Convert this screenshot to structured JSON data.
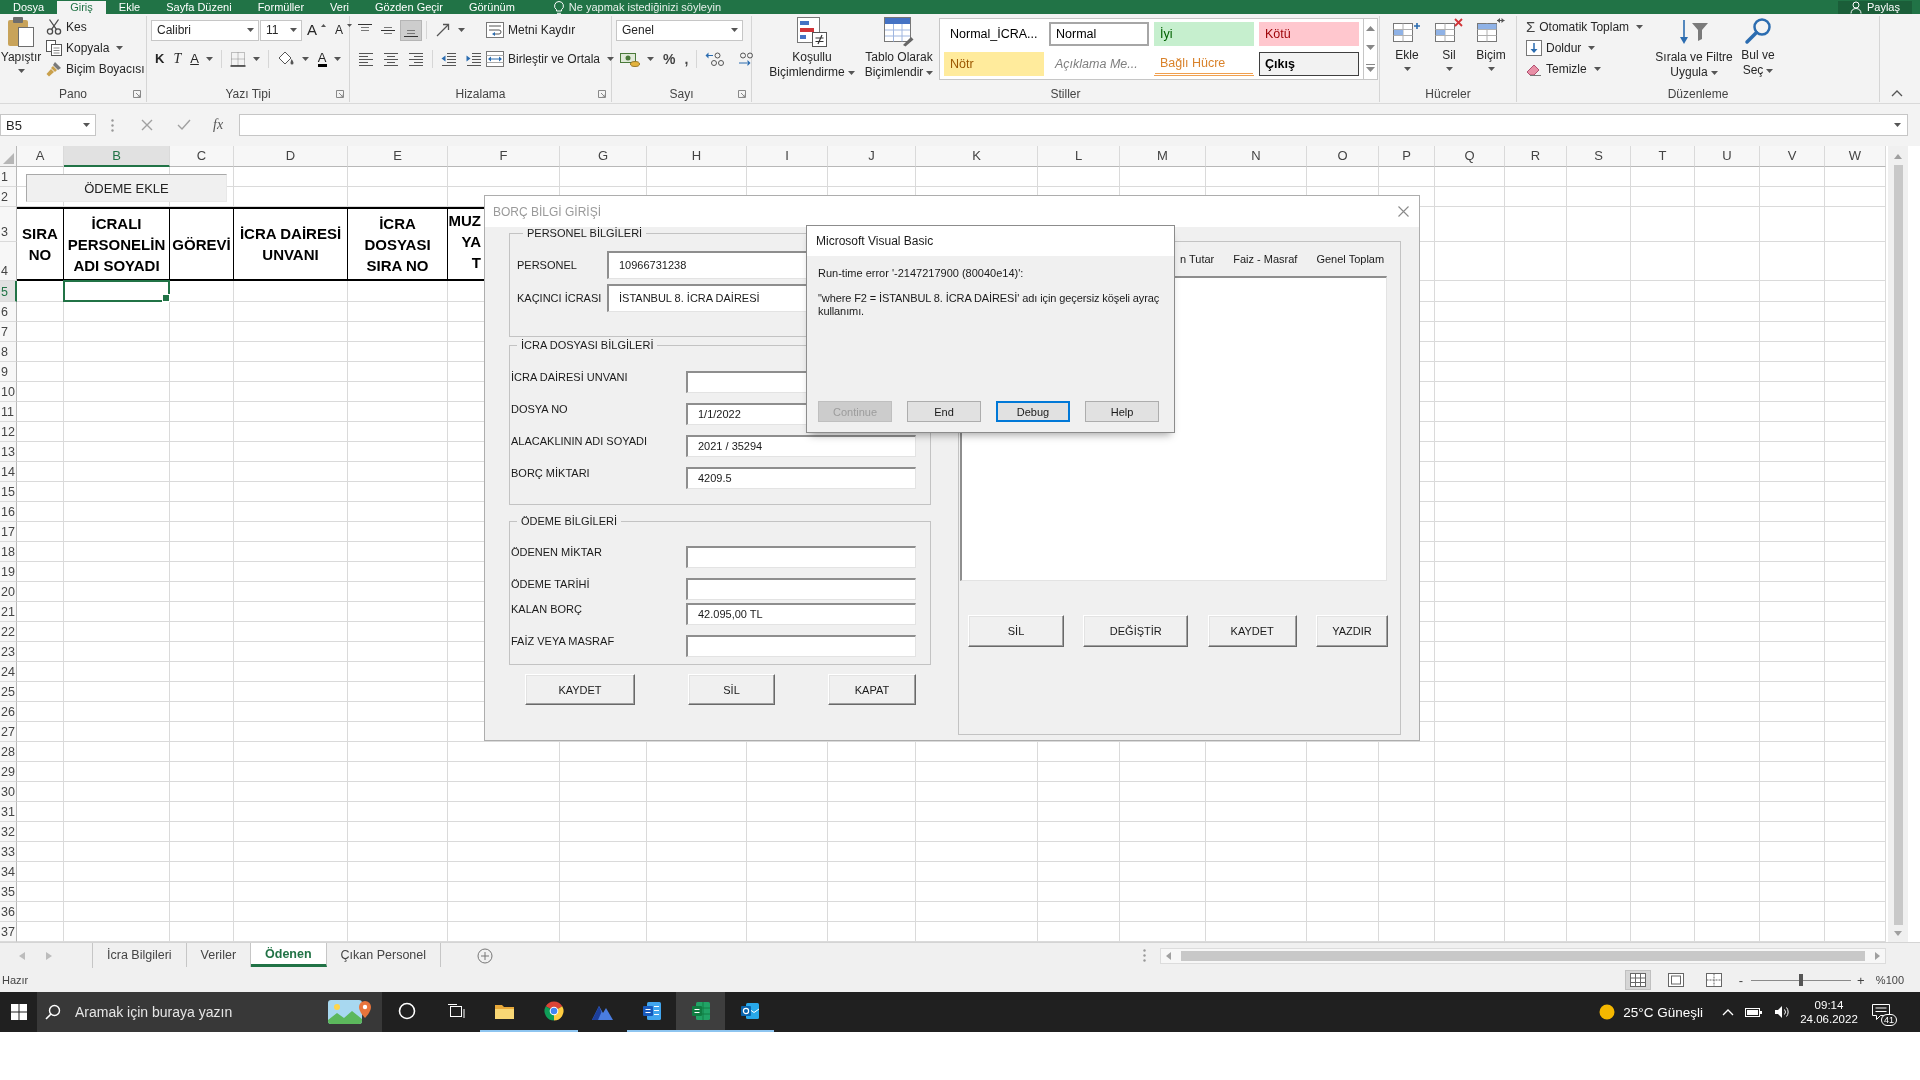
{
  "ribbon_tabs": [
    {
      "label": "Dosya",
      "selected": false
    },
    {
      "label": "Giriş",
      "selected": true
    },
    {
      "label": "Ekle",
      "selected": false
    },
    {
      "label": "Sayfa Düzeni",
      "selected": false
    },
    {
      "label": "Formüller",
      "selected": false
    },
    {
      "label": "Veri",
      "selected": false
    },
    {
      "label": "Gözden Geçir",
      "selected": false
    },
    {
      "label": "Görünüm",
      "selected": false
    }
  ],
  "tell_me": "Ne yapmak istediğinizi söyleyin",
  "share": "Paylaş",
  "ribbon": {
    "clipboard": {
      "label": "Pano",
      "paste": "Yapıştır",
      "cut": "Kes",
      "copy": "Kopyala",
      "format_painter": "Biçim Boyacısı"
    },
    "font": {
      "label": "Yazı Tipi",
      "font_name": "Calibri",
      "font_size": "11",
      "grow": "A",
      "shrink": "A",
      "bold": "K",
      "italic": "T",
      "underline": "A",
      "font_color": "A"
    },
    "alignment": {
      "label": "Hizalama",
      "vertical": [
        {
          "kind": "top",
          "on": false
        },
        {
          "kind": "middle",
          "on": false
        },
        {
          "kind": "bottom",
          "on": true
        }
      ],
      "horizontal": [
        {
          "kind": "left",
          "on": false
        },
        {
          "kind": "center",
          "on": false
        },
        {
          "kind": "right",
          "on": false
        }
      ],
      "wrap_text": "Metni Kaydır",
      "merge_center": "Birleştir ve Ortala"
    },
    "number": {
      "label": "Sayı",
      "format": "Genel",
      "percent": "%",
      "comma": ","
    },
    "styles": {
      "label": "Stiller",
      "conditional": "Koşullu Biçimlendirme",
      "format_table": "Tablo Olarak Biçimlendir",
      "gallery": [
        {
          "label": "Normal_İCRA...",
          "kind": "custom",
          "selected": false
        },
        {
          "label": "Normal",
          "kind": "normal",
          "selected": true
        },
        {
          "label": "İyi",
          "kind": "good",
          "selected": false
        },
        {
          "label": "Kötü",
          "kind": "bad",
          "selected": false
        },
        {
          "label": "Nötr",
          "kind": "neutral",
          "selected": false
        },
        {
          "label": "Açıklama Me...",
          "kind": "explanatory",
          "selected": false
        },
        {
          "label": "Bağlı Hücre",
          "kind": "linked",
          "selected": false
        },
        {
          "label": "Çıkış",
          "kind": "output",
          "selected": false
        }
      ]
    },
    "cells": {
      "label": "Hücreler",
      "buttons": [
        {
          "kind": "insert",
          "label": "Ekle"
        },
        {
          "kind": "delete",
          "label": "Sil"
        },
        {
          "kind": "format",
          "label": "Biçim"
        }
      ]
    },
    "editing": {
      "label": "Düzenleme",
      "autosum_symbol": "Σ",
      "autosum": "Otomatik Toplam",
      "fill": "Doldur",
      "clear": "Temizle",
      "sort_filter": "Sırala ve Filtre Uygula",
      "find_select": "Bul ve Seç"
    }
  },
  "formula_bar": {
    "name_box": "B5",
    "function_symbol": "fx"
  },
  "sheet": {
    "columns": [
      {
        "label": "A",
        "selected": false
      },
      {
        "label": "B",
        "selected": true
      },
      {
        "label": "C",
        "selected": false
      },
      {
        "label": "D",
        "selected": false
      },
      {
        "label": "E",
        "selected": false
      },
      {
        "label": "F",
        "selected": false
      },
      {
        "label": "G",
        "selected": false
      },
      {
        "label": "H",
        "selected": false
      },
      {
        "label": "I",
        "selected": false
      },
      {
        "label": "J",
        "selected": false
      },
      {
        "label": "K",
        "selected": false
      },
      {
        "label": "L",
        "selected": false
      },
      {
        "label": "M",
        "selected": false
      },
      {
        "label": "N",
        "selected": false
      },
      {
        "label": "O",
        "selected": false
      },
      {
        "label": "P",
        "selected": false
      },
      {
        "label": "Q",
        "selected": false
      },
      {
        "label": "R",
        "selected": false
      },
      {
        "label": "S",
        "selected": false
      },
      {
        "label": "T",
        "selected": false
      },
      {
        "label": "U",
        "selected": false
      },
      {
        "label": "V",
        "selected": false
      },
      {
        "label": "W",
        "selected": false
      }
    ],
    "rows": [
      {
        "label": "1",
        "selected": false
      },
      {
        "label": "2",
        "selected": false
      },
      {
        "label": "3",
        "selected": false
      },
      {
        "label": "4",
        "selected": false
      },
      {
        "label": "5",
        "selected": true
      },
      {
        "label": "6",
        "selected": false
      },
      {
        "label": "7",
        "selected": false
      },
      {
        "label": "8",
        "selected": false
      },
      {
        "label": "9",
        "selected": false
      },
      {
        "label": "10",
        "selected": false
      },
      {
        "label": "11",
        "selected": false
      },
      {
        "label": "12",
        "selected": false
      },
      {
        "label": "13",
        "selected": false
      },
      {
        "label": "14",
        "selected": false
      },
      {
        "label": "15",
        "selected": false
      },
      {
        "label": "16",
        "selected": false
      },
      {
        "label": "17",
        "selected": false
      },
      {
        "label": "18",
        "selected": false
      },
      {
        "label": "19",
        "selected": false
      },
      {
        "label": "20",
        "selected": false
      },
      {
        "label": "21",
        "selected": false
      },
      {
        "label": "22",
        "selected": false
      },
      {
        "label": "23",
        "selected": false
      },
      {
        "label": "24",
        "selected": false
      },
      {
        "label": "25",
        "selected": false
      },
      {
        "label": "26",
        "selected": false
      },
      {
        "label": "27",
        "selected": false
      },
      {
        "label": "28",
        "selected": false
      },
      {
        "label": "29",
        "selected": false
      },
      {
        "label": "30",
        "selected": false
      },
      {
        "label": "31",
        "selected": false
      },
      {
        "label": "32",
        "selected": false
      },
      {
        "label": "33",
        "selected": false
      },
      {
        "label": "34",
        "selected": false
      },
      {
        "label": "35",
        "selected": false
      },
      {
        "label": "36",
        "selected": false
      },
      {
        "label": "37",
        "selected": false
      }
    ],
    "macro_button": "ÖDEME EKLE",
    "header_cells": [
      "SIRA NO",
      "İCRALI PERSONELİN ADI SOYADI",
      "GÖREVİ",
      "İCRA DAİRESİ UNVANI",
      "İCRA DOSYASI SIRA NO",
      "MUZ YA T"
    ]
  },
  "form": {
    "title": "BORÇ BİLGİ GİRİŞİ",
    "sections": [
      {
        "title": "PERSONEL BİLGİLERİ",
        "kind": "multiline",
        "fields": [
          {
            "label": "PERSONEL",
            "value": "10966731238"
          },
          {
            "label": "KAÇINCI İCRASI",
            "value": "İSTANBUL 8. İCRA DAİRESİ"
          }
        ]
      },
      {
        "title": "İCRA DOSYASI BİLGİLERİ",
        "kind": "singleline",
        "fields": [
          {
            "label": "İCRA DAİRESİ UNVANI"
          },
          {
            "label": "DOSYA NO",
            "value": "1/1/2022"
          },
          {
            "label": "ALACAKLININ ADI SOYADI",
            "value": "2021 / 35294"
          },
          {
            "label": "BORÇ MİKTARI",
            "value": "4209.5"
          }
        ]
      },
      {
        "title": "ÖDEME BİLGİLERİ",
        "kind": "singleline",
        "fields": [
          {
            "label": "ÖDENEN MİKTAR"
          },
          {
            "label": "ÖDEME TARİHİ"
          },
          {
            "label": "KALAN BORÇ",
            "value": "42.095,00 TL"
          },
          {
            "label": "FAİZ VEYA MASRAF"
          }
        ]
      }
    ],
    "buttons": [
      "KAYDET",
      "SİL",
      "KAPAT"
    ],
    "list_columns": [
      "n Tutar",
      "Faiz - Masraf",
      "Genel Toplam"
    ],
    "list_buttons": [
      "SİL",
      "DEĞİŞTİR",
      "KAYDET",
      "YAZDIR"
    ]
  },
  "error_dialog": {
    "title": "Microsoft Visual Basic",
    "error": "Run-time error '-2147217900 (80040e14)':",
    "message": "\"where F2 = İSTANBUL 8. İCRA DAİRESİ' adı için geçersiz köşeli ayraç kullanımı.",
    "buttons": [
      {
        "label": "Continue",
        "disabled": true,
        "focused": false
      },
      {
        "label": "End",
        "disabled": false,
        "focused": false
      },
      {
        "label": "Debug",
        "disabled": false,
        "focused": true
      },
      {
        "label": "Help",
        "disabled": false,
        "focused": false
      }
    ]
  },
  "sheet_tabs": [
    {
      "label": "İcra Bilgileri",
      "selected": false
    },
    {
      "label": "Veriler",
      "selected": false
    },
    {
      "label": "Ödenen",
      "selected": true
    },
    {
      "label": "Çıkan Personel",
      "selected": false
    }
  ],
  "status_bar": {
    "status": "Hazır",
    "views": [
      {
        "kind": "normal",
        "selected": true
      },
      {
        "kind": "page_layout",
        "selected": false
      },
      {
        "kind": "page_break",
        "selected": false
      }
    ],
    "zoom_out": "-",
    "zoom_slider": {
      "level": 0.5
    },
    "zoom_in": "+",
    "zoom": "%100"
  },
  "taskbar": {
    "search_placeholder": "Aramak için buraya yazın",
    "apps": [
      {
        "kind": "assistant",
        "running": false,
        "selected": false
      },
      {
        "kind": "task_view",
        "running": false,
        "selected": false
      },
      {
        "kind": "folder",
        "running": true,
        "selected": false
      },
      {
        "kind": "browser",
        "running": true,
        "selected": false
      },
      {
        "kind": "mountains",
        "running": false,
        "selected": false
      },
      {
        "kind": "documents",
        "running": true,
        "selected": false
      },
      {
        "kind": "spreadsheets",
        "running": true,
        "selected": true
      },
      {
        "kind": "mail",
        "running": true,
        "selected": false
      }
    ],
    "weather": "25°C Güneşli",
    "time": "09:14",
    "date": "24.06.2022",
    "notifications": "41"
  }
}
